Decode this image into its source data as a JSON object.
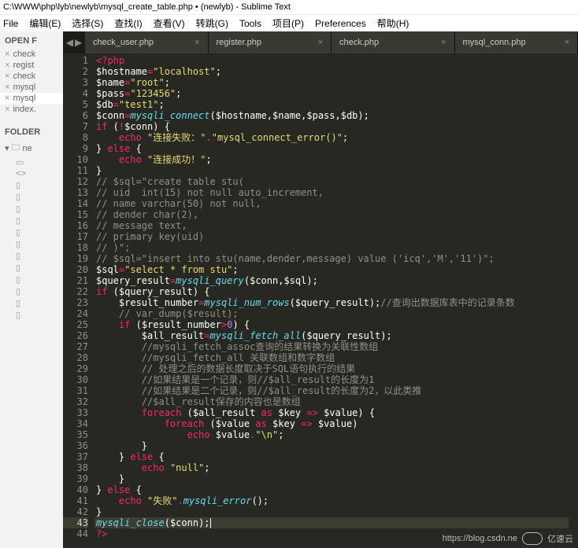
{
  "window": {
    "title": "C:\\WWW\\php\\lyb\\newlyb\\mysql_create_table.php • (newlyb) - Sublime Text"
  },
  "menu": {
    "items": [
      "File",
      "编辑(E)",
      "选择(S)",
      "查找(I)",
      "查看(V)",
      "转跳(G)",
      "Tools",
      "项目(P)",
      "Preferences",
      "帮助(H)"
    ]
  },
  "sidebar": {
    "openFilesTitle": "OPEN F",
    "open": [
      {
        "label": "check",
        "active": false
      },
      {
        "label": "regist",
        "active": false
      },
      {
        "label": "check",
        "active": false
      },
      {
        "label": "mysql",
        "active": false
      },
      {
        "label": "mysql",
        "active": true
      },
      {
        "label": "index.",
        "active": false
      }
    ],
    "foldersTitle": "FOLDER",
    "folder": "ne",
    "fileCount": 14
  },
  "tabs": [
    {
      "label": "check_user.php"
    },
    {
      "label": "register.php"
    },
    {
      "label": "check.php"
    },
    {
      "label": "mysql_conn.php"
    }
  ],
  "highlightLine": 43,
  "code": [
    [
      [
        "tag",
        "<?php"
      ]
    ],
    [
      [
        "var",
        "$hostname"
      ],
      [
        "op",
        "="
      ],
      [
        "str",
        "\"localhost\""
      ],
      [
        "punc",
        ";"
      ]
    ],
    [
      [
        "var",
        "$name"
      ],
      [
        "op",
        "="
      ],
      [
        "str",
        "\"root\""
      ],
      [
        "punc",
        ";"
      ]
    ],
    [
      [
        "var",
        "$pass"
      ],
      [
        "op",
        "="
      ],
      [
        "str",
        "\"123456\""
      ],
      [
        "punc",
        ";"
      ]
    ],
    [
      [
        "var",
        "$db"
      ],
      [
        "op",
        "="
      ],
      [
        "str",
        "\"test1\""
      ],
      [
        "punc",
        ";"
      ]
    ],
    [
      [
        "var",
        "$conn"
      ],
      [
        "op",
        "="
      ],
      [
        "fn",
        "mysqli_connect"
      ],
      [
        "punc",
        "("
      ],
      [
        "var",
        "$hostname"
      ],
      [
        "punc",
        ","
      ],
      [
        "var",
        "$name"
      ],
      [
        "punc",
        ","
      ],
      [
        "var",
        "$pass"
      ],
      [
        "punc",
        ","
      ],
      [
        "var",
        "$db"
      ],
      [
        "punc",
        ");"
      ]
    ],
    [
      [
        "kw",
        "if"
      ],
      [
        "punc",
        " ("
      ],
      [
        "op",
        "!"
      ],
      [
        "var",
        "$conn"
      ],
      [
        "punc",
        ") {"
      ]
    ],
    [
      [
        "sp",
        "    "
      ],
      [
        "kw",
        "echo"
      ],
      [
        "punc",
        " "
      ],
      [
        "str",
        "\"连接失败：\""
      ],
      [
        "op",
        "."
      ],
      [
        "str",
        "\"mysql_connect_error()\""
      ],
      [
        "punc",
        ";"
      ]
    ],
    [
      [
        "punc",
        "} "
      ],
      [
        "kw",
        "else"
      ],
      [
        "punc",
        " {"
      ]
    ],
    [
      [
        "sp",
        "    "
      ],
      [
        "kw",
        "echo"
      ],
      [
        "punc",
        " "
      ],
      [
        "str",
        "\"连接成功！\""
      ],
      [
        "punc",
        ";"
      ]
    ],
    [
      [
        "punc",
        "}"
      ]
    ],
    [
      [
        "cmt",
        "// $sql=\"create table stu("
      ]
    ],
    [
      [
        "cmt",
        "// uid  int(15) not null auto_increment,"
      ]
    ],
    [
      [
        "cmt",
        "// name varchar(50) not null,"
      ]
    ],
    [
      [
        "cmt",
        "// dender char(2),"
      ]
    ],
    [
      [
        "cmt",
        "// message text,"
      ]
    ],
    [
      [
        "cmt",
        "// primary key(uid)"
      ]
    ],
    [
      [
        "cmt",
        "// )\";"
      ]
    ],
    [
      [
        "cmt",
        "// $sql=\"insert into stu(name,dender,message) value ('icq','M','11')\";"
      ]
    ],
    [
      [
        "var",
        "$sql"
      ],
      [
        "op",
        "="
      ],
      [
        "str",
        "\"select * from stu\""
      ],
      [
        "punc",
        ";"
      ]
    ],
    [
      [
        "var",
        "$query_result"
      ],
      [
        "op",
        "="
      ],
      [
        "fn",
        "mysqli_query"
      ],
      [
        "punc",
        "("
      ],
      [
        "var",
        "$conn"
      ],
      [
        "punc",
        ","
      ],
      [
        "var",
        "$sql"
      ],
      [
        "punc",
        ");"
      ]
    ],
    [
      [
        "kw",
        "if"
      ],
      [
        "punc",
        " ("
      ],
      [
        "var",
        "$query_result"
      ],
      [
        "punc",
        ") {"
      ]
    ],
    [
      [
        "sp",
        "    "
      ],
      [
        "var",
        "$result_number"
      ],
      [
        "op",
        "="
      ],
      [
        "fn",
        "mysqli_num_rows"
      ],
      [
        "punc",
        "("
      ],
      [
        "var",
        "$query_result"
      ],
      [
        "punc",
        ");"
      ],
      [
        "cmt",
        "//查询出数据库表中的记录条数"
      ]
    ],
    [
      [
        "sp",
        "    "
      ],
      [
        "cmt",
        "// var_dump($result);"
      ]
    ],
    [
      [
        "sp",
        "    "
      ],
      [
        "kw",
        "if"
      ],
      [
        "punc",
        " ("
      ],
      [
        "var",
        "$result_number"
      ],
      [
        "op",
        ">"
      ],
      [
        "num",
        "0"
      ],
      [
        "punc",
        ") {"
      ]
    ],
    [
      [
        "sp",
        "        "
      ],
      [
        "var",
        "$all_result"
      ],
      [
        "op",
        "="
      ],
      [
        "fn",
        "mysqli_fetch_all"
      ],
      [
        "punc",
        "("
      ],
      [
        "var",
        "$query_result"
      ],
      [
        "punc",
        ");"
      ]
    ],
    [
      [
        "sp",
        "        "
      ],
      [
        "cmt",
        "//mysqli_fetch_assoc查询的结果转换为关联性数组"
      ]
    ],
    [
      [
        "sp",
        "        "
      ],
      [
        "cmt",
        "//mysqli_fetch_all 关联数组和数字数组"
      ]
    ],
    [
      [
        "sp",
        "        "
      ],
      [
        "cmt",
        "// 处理之后的数据长度取决于SQL语句执行的结果"
      ]
    ],
    [
      [
        "sp",
        "        "
      ],
      [
        "cmt",
        "//如果结果是一个记录，则//$all_result的长度为1"
      ]
    ],
    [
      [
        "sp",
        "        "
      ],
      [
        "cmt",
        "//如果结果是二个记录，则//$all_result的长度为2，以此类推"
      ]
    ],
    [
      [
        "sp",
        "        "
      ],
      [
        "cmt",
        "//$all_result保存的内容也是数组"
      ]
    ],
    [
      [
        "sp",
        "        "
      ],
      [
        "kw",
        "foreach"
      ],
      [
        "punc",
        " ("
      ],
      [
        "var",
        "$all_result"
      ],
      [
        "punc",
        " "
      ],
      [
        "kw",
        "as"
      ],
      [
        "punc",
        " "
      ],
      [
        "var",
        "$key"
      ],
      [
        "punc",
        " "
      ],
      [
        "op",
        "=>"
      ],
      [
        "punc",
        " "
      ],
      [
        "var",
        "$value"
      ],
      [
        "punc",
        ") {"
      ]
    ],
    [
      [
        "sp",
        "            "
      ],
      [
        "kw",
        "foreach"
      ],
      [
        "punc",
        " ("
      ],
      [
        "var",
        "$value"
      ],
      [
        "punc",
        " "
      ],
      [
        "kw",
        "as"
      ],
      [
        "punc",
        " "
      ],
      [
        "var",
        "$key"
      ],
      [
        "punc",
        " "
      ],
      [
        "op",
        "=>"
      ],
      [
        "punc",
        " "
      ],
      [
        "var",
        "$value"
      ],
      [
        "punc",
        ")"
      ]
    ],
    [
      [
        "sp",
        "                "
      ],
      [
        "kw",
        "echo"
      ],
      [
        "punc",
        " "
      ],
      [
        "var",
        "$value"
      ],
      [
        "op",
        "."
      ],
      [
        "str",
        "\"\\n\""
      ],
      [
        "punc",
        ";"
      ]
    ],
    [
      [
        "sp",
        "        "
      ],
      [
        "punc",
        "}"
      ]
    ],
    [
      [
        "sp",
        "    "
      ],
      [
        "punc",
        "} "
      ],
      [
        "kw",
        "else"
      ],
      [
        "punc",
        " {"
      ]
    ],
    [
      [
        "sp",
        "        "
      ],
      [
        "kw",
        "echo"
      ],
      [
        "punc",
        " "
      ],
      [
        "str",
        "\"null\""
      ],
      [
        "punc",
        ";"
      ]
    ],
    [
      [
        "sp",
        "    "
      ],
      [
        "punc",
        "}"
      ]
    ],
    [
      [
        "punc",
        "} "
      ],
      [
        "kw",
        "else"
      ],
      [
        "punc",
        " {"
      ]
    ],
    [
      [
        "sp",
        "    "
      ],
      [
        "kw",
        "echo"
      ],
      [
        "punc",
        " "
      ],
      [
        "str",
        "\"失败\""
      ],
      [
        "op",
        "."
      ],
      [
        "fn",
        "mysqli_error"
      ],
      [
        "punc",
        "();"
      ]
    ],
    [
      [
        "punc",
        "}"
      ]
    ],
    [
      [
        "fn",
        "mysqli_close"
      ],
      [
        "punc",
        "("
      ],
      [
        "var",
        "$conn"
      ],
      [
        "punc",
        ");"
      ],
      [
        "cursor",
        ""
      ]
    ],
    [
      [
        "tag",
        "?>"
      ]
    ]
  ],
  "watermark": {
    "url": "https://blog.csdn.ne",
    "brand": "亿速云"
  }
}
